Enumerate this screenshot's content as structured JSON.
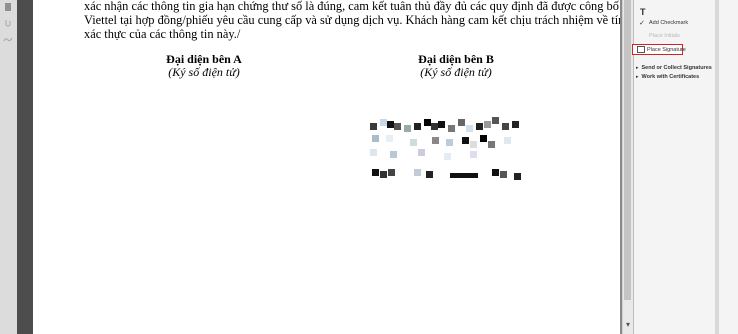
{
  "document": {
    "lines": [
      "xác nhận các thông tin gia hạn chứng thư số là đúng, cam kết tuân thủ đầy đủ các quy định đã được công bố của",
      "Viettel tại hợp đồng/phiếu yêu cầu cung cấp và sử dụng dịch vụ. Khách hàng cam kết chịu trách nhiệm về tính",
      "xác thực của các thông tin này./"
    ],
    "party_a": {
      "title": "Đại diện bên A",
      "subtitle": "(Ký số điện tử)"
    },
    "party_b": {
      "title": "Đại diện bên B",
      "subtitle": "(Ký số điện tử)"
    }
  },
  "right_panel": {
    "header": "T",
    "items": [
      {
        "label": "Add Checkmark",
        "icon": "checkmark-icon",
        "enabled": true
      },
      {
        "label": "Place Initials",
        "icon": "initials-icon",
        "enabled": false
      },
      {
        "label": "Place Signature",
        "icon": "signature-icon",
        "enabled": true,
        "highlighted": true
      }
    ],
    "sections": [
      {
        "label": "Send or Collect Signatures"
      },
      {
        "label": "Work with Certificates"
      }
    ]
  },
  "colors": {
    "highlight_border": "#d81f1f",
    "left_gutter": "#4d4d4d"
  }
}
